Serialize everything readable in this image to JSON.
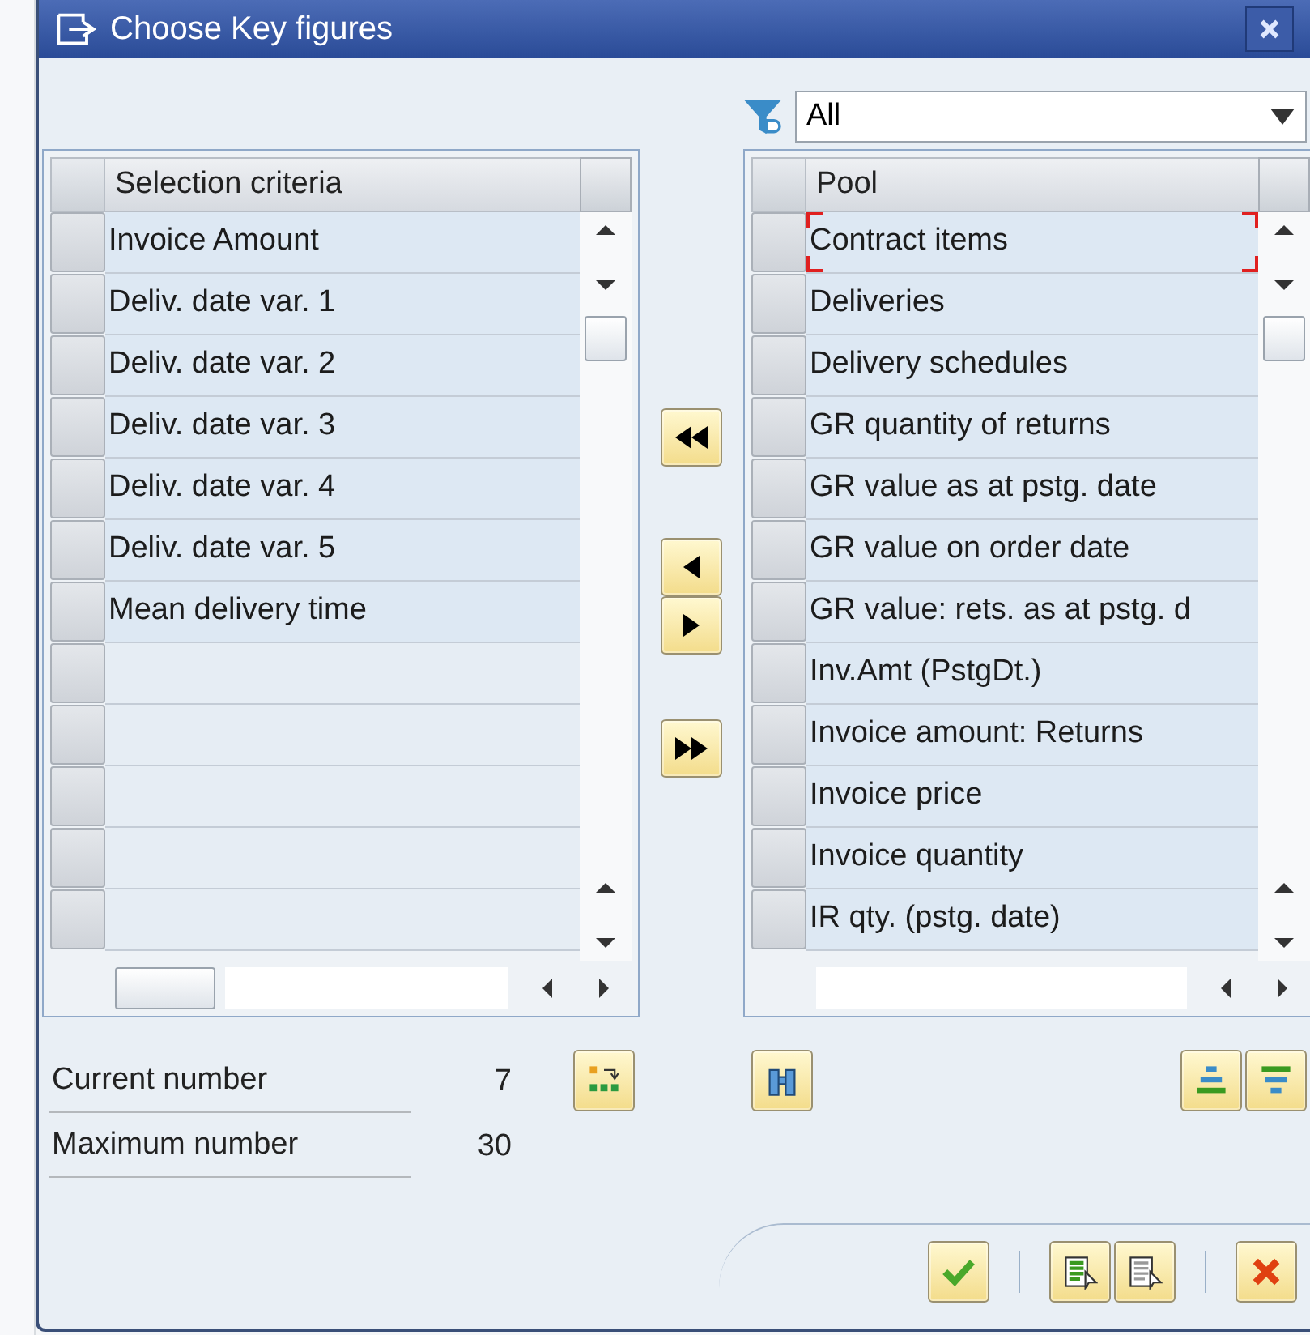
{
  "window": {
    "title": "Choose Key figures"
  },
  "filter": {
    "value": "All"
  },
  "selection_table": {
    "header": "Selection criteria",
    "rows": [
      "Invoice Amount",
      "Deliv. date var. 1",
      "Deliv. date var. 2",
      "Deliv. date var. 3",
      "Deliv. date var. 4",
      "Deliv. date var. 5",
      "Mean delivery time"
    ]
  },
  "pool_table": {
    "header": "Pool",
    "rows": [
      {
        "label": "Contract items",
        "focused": true
      },
      {
        "label": "Deliveries",
        "focused": false
      },
      {
        "label": "Delivery schedules",
        "focused": false
      },
      {
        "label": "GR quantity of returns",
        "focused": false
      },
      {
        "label": "GR value as at pstg. date",
        "focused": false
      },
      {
        "label": "GR value on order date",
        "focused": false
      },
      {
        "label": "GR value: rets. as at pstg. d",
        "focused": false
      },
      {
        "label": "Inv.Amt (PstgDt.)",
        "focused": false
      },
      {
        "label": "Invoice amount: Returns",
        "focused": false
      },
      {
        "label": "Invoice price",
        "focused": false
      },
      {
        "label": "Invoice quantity",
        "focused": false
      },
      {
        "label": "IR qty. (pstg. date)",
        "focused": false
      }
    ]
  },
  "counts": [
    {
      "label": "Current number",
      "value": "7"
    },
    {
      "label": "Maximum number",
      "value": "30"
    }
  ]
}
